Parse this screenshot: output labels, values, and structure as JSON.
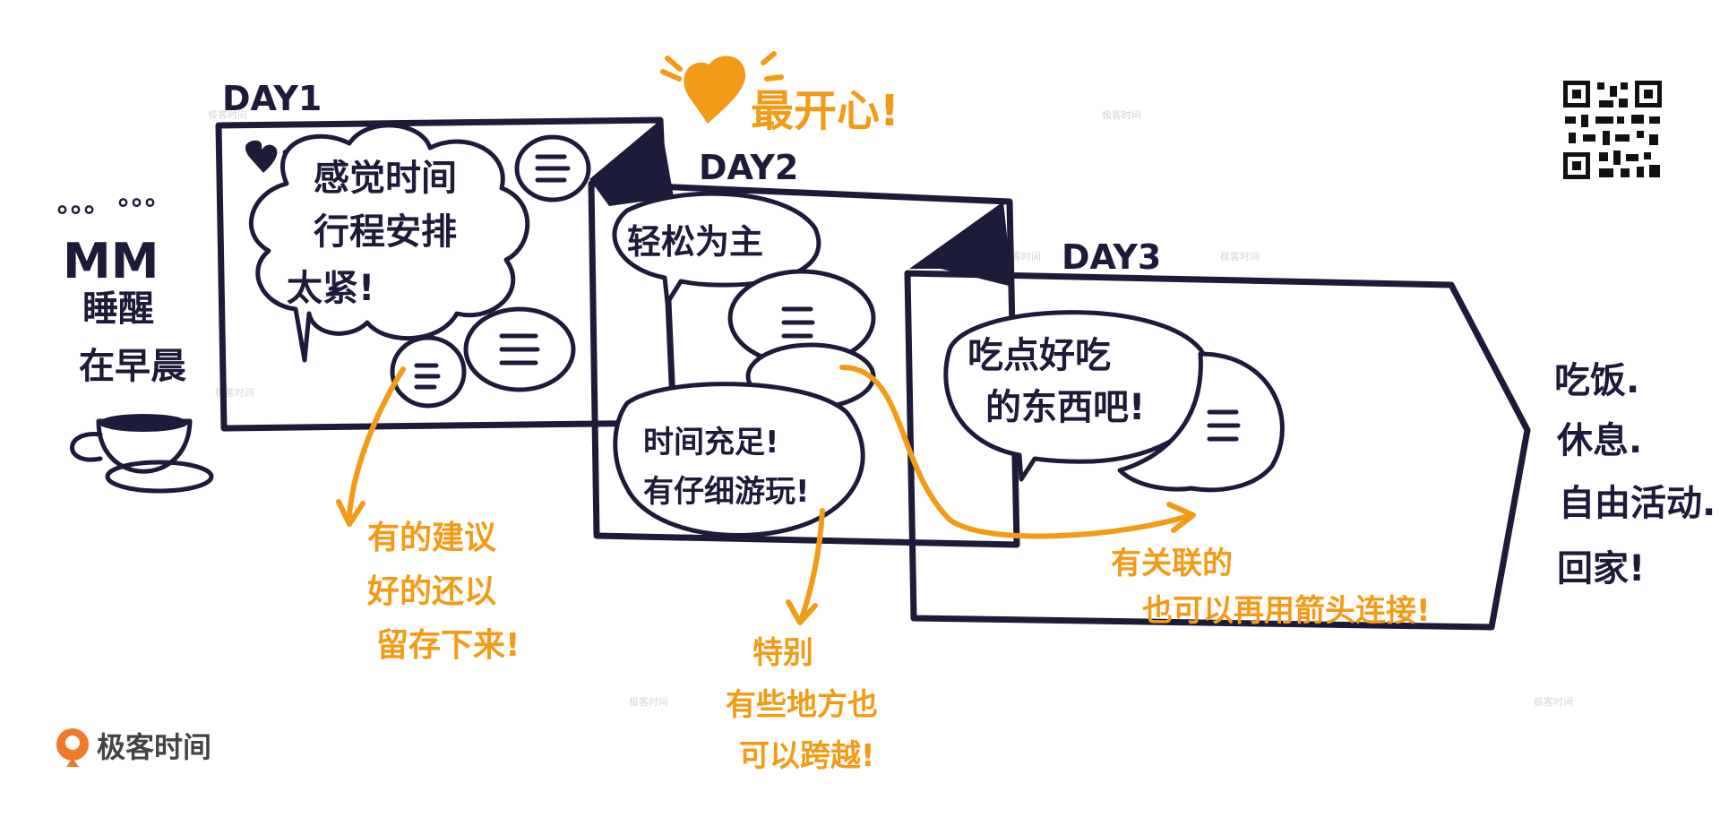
{
  "colors": {
    "ink": "#1c1b3a",
    "accent_orange": "#f39b16",
    "background": "#ffffff"
  },
  "heart_label": "最开心!",
  "days": {
    "day1": {
      "title": "DAY1",
      "bubble_lines": [
        "感觉时间",
        "行程安排",
        "太紧!"
      ]
    },
    "day2": {
      "title": "DAY2",
      "bubble_top": "轻松为主",
      "bubble_bottom_lines": [
        "时间充足!",
        "有仔细游玩!"
      ]
    },
    "day3": {
      "title": "DAY3",
      "bubble_lines": [
        "吃点好吃",
        "的东西吧!"
      ]
    }
  },
  "left_note": {
    "sound": "°°°",
    "lines": [
      "MM",
      "睡醒",
      "在早晨"
    ]
  },
  "right_note": {
    "lines": [
      "吃饭.",
      "休息.",
      "自由活动.",
      "回家!"
    ]
  },
  "annotations": {
    "note1_lines": [
      "有的建议",
      "好的还以",
      "留存下来!"
    ],
    "note2_lines": [
      "特别",
      "有些地方也",
      "可以跨越!"
    ],
    "note3_lines": [
      "有关联的",
      "也可以再用箭头连接!"
    ]
  },
  "logo_text": "极客时间",
  "watermark_text": "极客时间",
  "icons": [
    "heart-icon",
    "coffee-cup-icon",
    "qr-code-icon",
    "geek-time-logo-icon"
  ]
}
